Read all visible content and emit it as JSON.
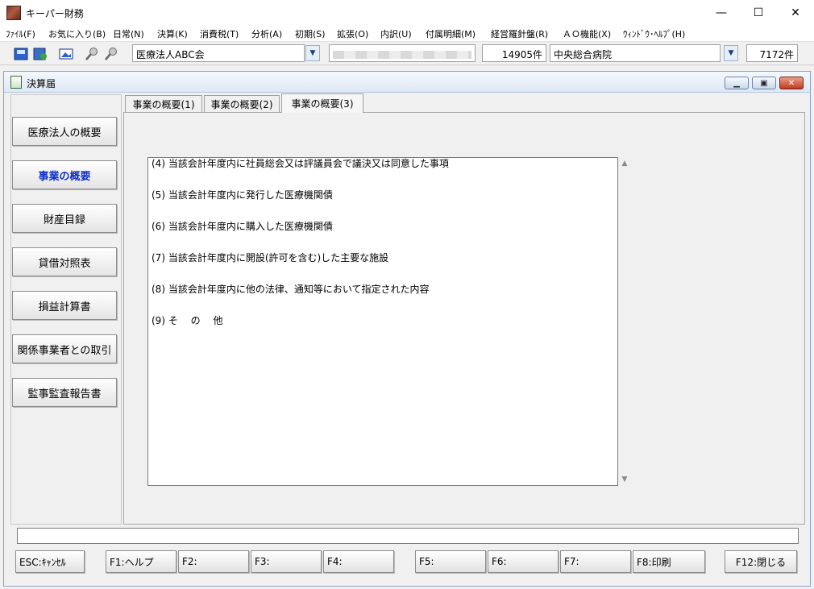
{
  "window": {
    "title": "キーパー財務",
    "minimize": "—",
    "maximize": "☐",
    "close": "✕"
  },
  "menu": [
    "ﾌｧｲﾙ(F)",
    "お気に入り(B)",
    "日常(N)",
    "決算(K)",
    "消費税(T)",
    "分析(A)",
    "初期(S)",
    "拡張(O)",
    "内訳(U)",
    "付属明細(M)",
    "経営羅針盤(R)",
    "ＡＯ機能(X)",
    "ｳｨﾝﾄﾞｳ･ﾍﾙﾌﾟ(H)"
  ],
  "toolbar": {
    "company": "医療法人ABC会",
    "company_count": "14905件",
    "facility": "中央総合病院",
    "facility_count": "7172件",
    "icons": [
      "save-icon",
      "refresh-icon",
      "image-icon",
      "search-icon",
      "search-next-icon"
    ]
  },
  "child": {
    "title": "決算届"
  },
  "nav": [
    {
      "label": "医療法人の概要",
      "active": false
    },
    {
      "label": "事業の概要",
      "active": true
    },
    {
      "label": "財産目録",
      "active": false
    },
    {
      "label": "貸借対照表",
      "active": false
    },
    {
      "label": "損益計算書",
      "active": false
    },
    {
      "label": "関係事業者との取引",
      "active": false
    },
    {
      "label": "監事監査報告書",
      "active": false
    }
  ],
  "tabs": [
    {
      "label": "事業の概要(1)",
      "active": false
    },
    {
      "label": "事業の概要(2)",
      "active": false
    },
    {
      "label": "事業の概要(3)",
      "active": true
    }
  ],
  "content_lines": [
    "(4) 当該会計年度内に社員総会又は評議員会で議決又は同意した事項",
    "(5) 当該会計年度内に発行した医療機関債",
    "(6) 当該会計年度内に購入した医療機関債",
    "(7) 当該会計年度内に開設(許可を含む)した主要な施設",
    "(8) 当該会計年度内に他の法律、通知等において指定された内容",
    "(9) そ　 の　 他"
  ],
  "fkeys": [
    "ESC:ｷｬﾝｾﾙ",
    "F1:ヘルプ",
    "F2:",
    "F3:",
    "F4:",
    "F5:",
    "F6:",
    "F7:",
    "F8:印刷",
    "F12:閉じる"
  ]
}
